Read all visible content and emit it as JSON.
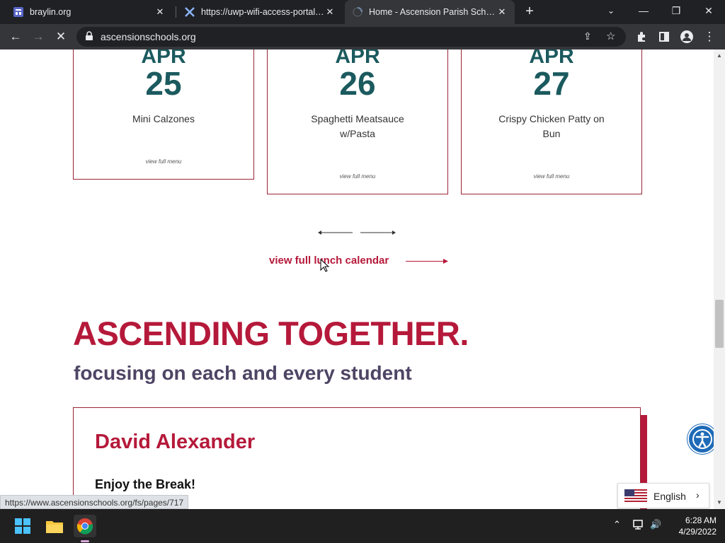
{
  "browser": {
    "tabs": [
      {
        "title": "braylin.org",
        "active": false,
        "icon": "site-icon"
      },
      {
        "title": "https://uwp-wifi-access-portal.co",
        "active": false,
        "icon": "portal-icon"
      },
      {
        "title": "Home - Ascension Parish School",
        "active": true,
        "icon": "loading-spinner-icon"
      }
    ],
    "new_tab_label": "+",
    "address": "ascensionschools.org",
    "status_url": "https://www.ascensionschools.org/fs/pages/717"
  },
  "menus": [
    {
      "month": "APR",
      "day": "25",
      "meal": "Mini Calzones",
      "link": "view full menu"
    },
    {
      "month": "APR",
      "day": "26",
      "meal": "Spaghetti Meatsauce w/Pasta",
      "link": "view full menu"
    },
    {
      "month": "APR",
      "day": "27",
      "meal": "Crispy Chicken Patty on Bun",
      "link": "view full menu"
    }
  ],
  "lunch_calendar_link": "view full lunch calendar",
  "section": {
    "heading": "ASCENDING TOGETHER.",
    "subheading": "focusing on each and every student"
  },
  "message": {
    "name": "David Alexander",
    "title": "Enjoy the Break!"
  },
  "language": {
    "selected": "English"
  },
  "taskbar": {
    "time": "6:28 AM",
    "date": "4/29/2022"
  },
  "colors": {
    "brand_red": "#b5193a",
    "brand_teal": "#1b5a5e",
    "subheading_purple": "#4e4565",
    "accessibility_blue": "#1e6bb8"
  }
}
